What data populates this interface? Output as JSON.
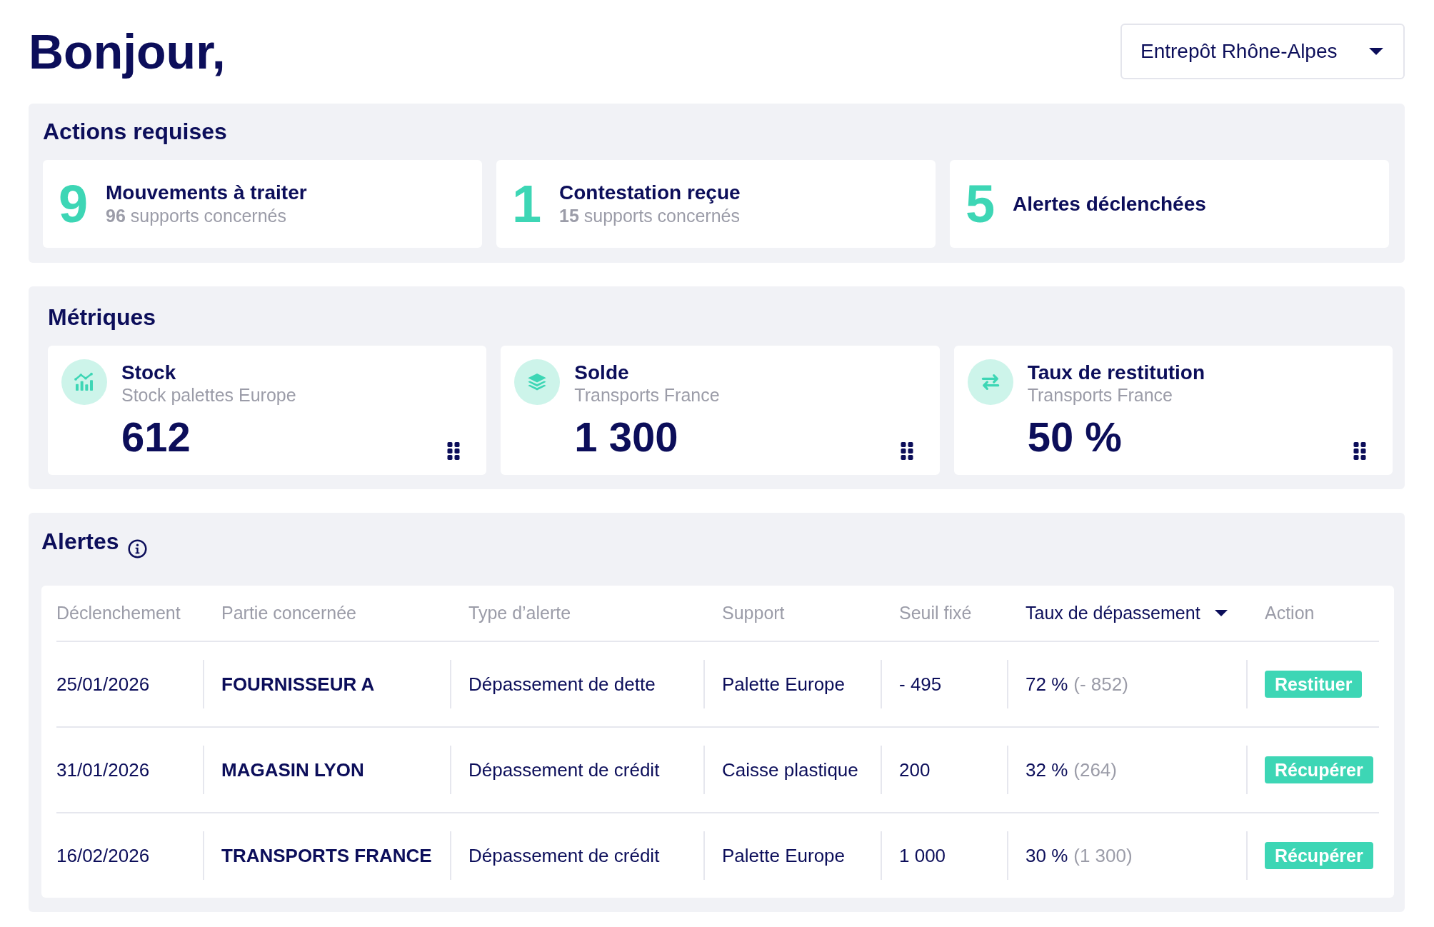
{
  "greeting": "Bonjour,",
  "warehouse_select": {
    "value": "Entrepôt Rhône-Alpes"
  },
  "actions": {
    "title": "Actions requises",
    "items": [
      {
        "count": "9",
        "title": "Mouvements à traiter",
        "subtitle": "**96** supports concernés"
      },
      {
        "count": "1",
        "title": "Contestation reçue",
        "subtitle": "**15** supports concernés"
      },
      {
        "count": "5",
        "title": "Alertes déclenchées"
      }
    ]
  },
  "metrics": {
    "title": "Métriques",
    "cards": [
      {
        "title": "Stock",
        "subtitle": "Stock palettes Europe",
        "value": "612"
      },
      {
        "title": "Solde",
        "subtitle": "Transports France",
        "value": "1 300"
      },
      {
        "title": "Taux de restitution",
        "subtitle": "Transports France",
        "value": "50 %"
      }
    ]
  },
  "alerts": {
    "title": "Alertes",
    "table": {
      "columns": [
        {
          "label": "Déclenchement",
          "sorted": false
        },
        {
          "label": "Partie concernée",
          "sorted": false
        },
        {
          "label": "Type d’alerte",
          "sorted": false
        },
        {
          "label": "Support",
          "sorted": false
        },
        {
          "label": "Seuil fixé",
          "sorted": false
        },
        {
          "label": "Taux de dépassement",
          "sorted": true
        },
        {
          "label": "Action",
          "sorted": false
        }
      ],
      "rows": [
        {
          "triggered": "25/01/2026",
          "party": "FOURNISSEUR A",
          "alert_type": "Dépassement de dette",
          "support": "Palette Europe",
          "threshold": "- 495",
          "rate": "72 %",
          "rate_detail": "(- 852)",
          "action": "Restituer"
        },
        {
          "triggered": "31/01/2026",
          "party": "MAGASIN LYON",
          "alert_type": "Dépassement de crédit",
          "support": "Caisse plastique",
          "threshold": "200",
          "rate": "32 %",
          "rate_detail": "(264)",
          "action": "Récupérer"
        },
        {
          "triggered": "16/02/2026",
          "party": "TRANSPORTS FRANCE",
          "alert_type": "Dépassement de crédit",
          "support": "Palette Europe",
          "threshold": "1 000",
          "rate": "30 %",
          "rate_detail": "(1 300)",
          "action": "Récupérer"
        }
      ]
    }
  }
}
